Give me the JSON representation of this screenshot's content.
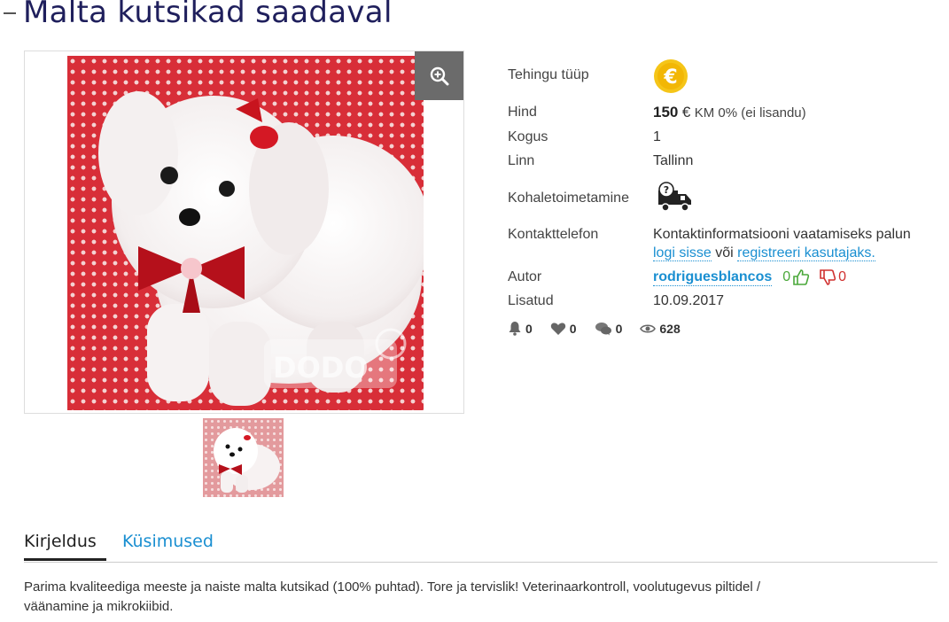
{
  "listing": {
    "title": "Malta kutsikad saadaval"
  },
  "gallery": {
    "watermark": "DODO"
  },
  "info": {
    "deal_type_label": "Tehingu tüüp",
    "deal_type_icon": "euro-coin-icon",
    "price_label": "Hind",
    "price_amount": "150",
    "price_currency": "€",
    "price_vat": "KM 0% (ei lisandu)",
    "quantity_label": "Kogus",
    "quantity_value": "1",
    "city_label": "Linn",
    "city_value": "Tallinn",
    "delivery_label": "Kohaletoimetamine",
    "delivery_icon": "delivery-truck-question-icon",
    "phone_label": "Kontakttelefon",
    "phone_text_1": "Kontaktinformatsiooni vaatamiseks palun",
    "phone_login_link": "logi sisse",
    "phone_text_2": "või",
    "phone_register_link": "registreeri kasutajaks",
    "phone_text_3": ".",
    "author_label": "Autor",
    "author_name": "rodriguesblancos",
    "author_likes": "0",
    "author_dislikes": "0",
    "added_label": "Lisatud",
    "added_date": "10.09.2017"
  },
  "stats": {
    "bell_count": "0",
    "heart_count": "0",
    "comments_count": "0",
    "views_count": "628"
  },
  "tabs": {
    "description_label": "Kirjeldus",
    "questions_label": "Küsimused"
  },
  "description": {
    "text": "Parima kvaliteediga meeste ja naiste malta kutsikad (100% puhtad). Tore ja tervislik! Veterinaarkontroll, voolutugevus piltidel / väänamine ja mikrokiibid."
  },
  "colors": {
    "title": "#1f1f5c",
    "link": "#1a8fd1",
    "like": "#4aa83a",
    "dislike": "#d0302f",
    "coin": "#f5c518"
  }
}
